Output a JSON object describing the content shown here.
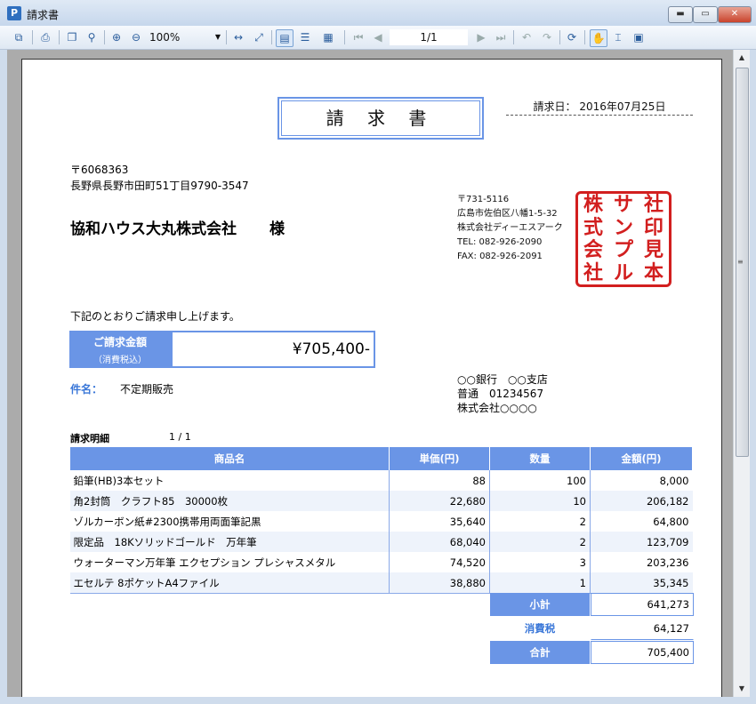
{
  "window": {
    "title": "請求書",
    "app_icon_glyph": "P",
    "min_glyph": "▬",
    "max_glyph": "▭",
    "close_glyph": "✕"
  },
  "toolbar": {
    "zoom_value": "100%",
    "zoom_caret": "▼",
    "page_indicator": "1/1",
    "icons": [
      {
        "name": "export-icon",
        "glyph": "⧉"
      },
      {
        "name": "print-icon",
        "glyph": "⎙"
      },
      {
        "name": "copy-icon",
        "glyph": "❐"
      },
      {
        "name": "find-icon",
        "glyph": "⚲"
      },
      {
        "name": "zoom-in-icon",
        "glyph": "⊕"
      },
      {
        "name": "zoom-out-icon",
        "glyph": "⊖"
      },
      {
        "name": "fit-width-icon",
        "glyph": "↔"
      },
      {
        "name": "fit-page-icon",
        "glyph": "⤢"
      },
      {
        "name": "single-page-icon",
        "glyph": "▤"
      },
      {
        "name": "continuous-icon",
        "glyph": "☰"
      },
      {
        "name": "multi-page-icon",
        "glyph": "▦"
      },
      {
        "name": "first-page-icon",
        "glyph": "⏮"
      },
      {
        "name": "prev-page-icon",
        "glyph": "◀"
      },
      {
        "name": "next-page-icon",
        "glyph": "▶"
      },
      {
        "name": "last-page-icon",
        "glyph": "⏭"
      },
      {
        "name": "back-icon",
        "glyph": "↶"
      },
      {
        "name": "forward-icon",
        "glyph": "↷"
      },
      {
        "name": "refresh-icon",
        "glyph": "⟳"
      },
      {
        "name": "hand-tool-icon",
        "glyph": "✋"
      },
      {
        "name": "select-tool-icon",
        "glyph": "⌶"
      },
      {
        "name": "snapshot-icon",
        "glyph": "▣"
      }
    ]
  },
  "invoice": {
    "title": "請 求 書",
    "issue_date": "請求日： 2016年07月25日",
    "customer": {
      "zip": "〒6068363",
      "address": "長野県長野市田町51丁目9790-3547",
      "name": "協和ハウス大丸株式会社",
      "honorific": "様"
    },
    "issuer": {
      "zip": "〒731-5116",
      "address": "広島市佐伯区八幡1-5-32",
      "company": "株式会社ディーエスアーク",
      "tel": "TEL: 082-926-2090",
      "fax": "FAX: 082-926-2091"
    },
    "seal_chars": [
      "株",
      "サ",
      "社",
      "式",
      "ン",
      "印",
      "会",
      "プ",
      "見",
      "社",
      "ル",
      "本"
    ],
    "greeting": "下記のとおりご請求申し上げます。",
    "amount_label": "ご請求金額",
    "amount_sublabel": "（消費税込）",
    "amount_value": "¥705,400-",
    "subject_label": "件名：",
    "subject_value": "不定期販売",
    "bank": {
      "line1": "○○銀行　○○支店",
      "line2": "普通　01234567",
      "line3": "株式会社○○○○"
    },
    "detail_title": "請求明細",
    "detail_page": "1 / 1",
    "table": {
      "headers": [
        "商品名",
        "単価(円)",
        "数量",
        "金額(円)"
      ],
      "rows": [
        [
          "鉛筆(HB)3本セット",
          "88",
          "100",
          "8,000"
        ],
        [
          "角2封筒　クラフト85　30000枚",
          "22,680",
          "10",
          "206,182"
        ],
        [
          "ゾルカーボン紙#2300携帯用両面筆記黒",
          "35,640",
          "2",
          "64,800"
        ],
        [
          "限定品　18Kソリッドゴールド　万年筆",
          "68,040",
          "2",
          "123,709"
        ],
        [
          "ウォーターマン万年筆 エクセプション プレシャスメタル",
          "74,520",
          "3",
          "203,236"
        ],
        [
          "エセルテ 8ポケットA4ファイル",
          "38,880",
          "1",
          "35,345"
        ]
      ]
    },
    "subtotal_label": "小計",
    "subtotal_value": "641,273",
    "tax_label": "消費税",
    "tax_value": "64,127",
    "total_label": "合計",
    "total_value": "705,400"
  },
  "colors": {
    "accent": "#6a95e6",
    "seal": "#d21f1f"
  }
}
